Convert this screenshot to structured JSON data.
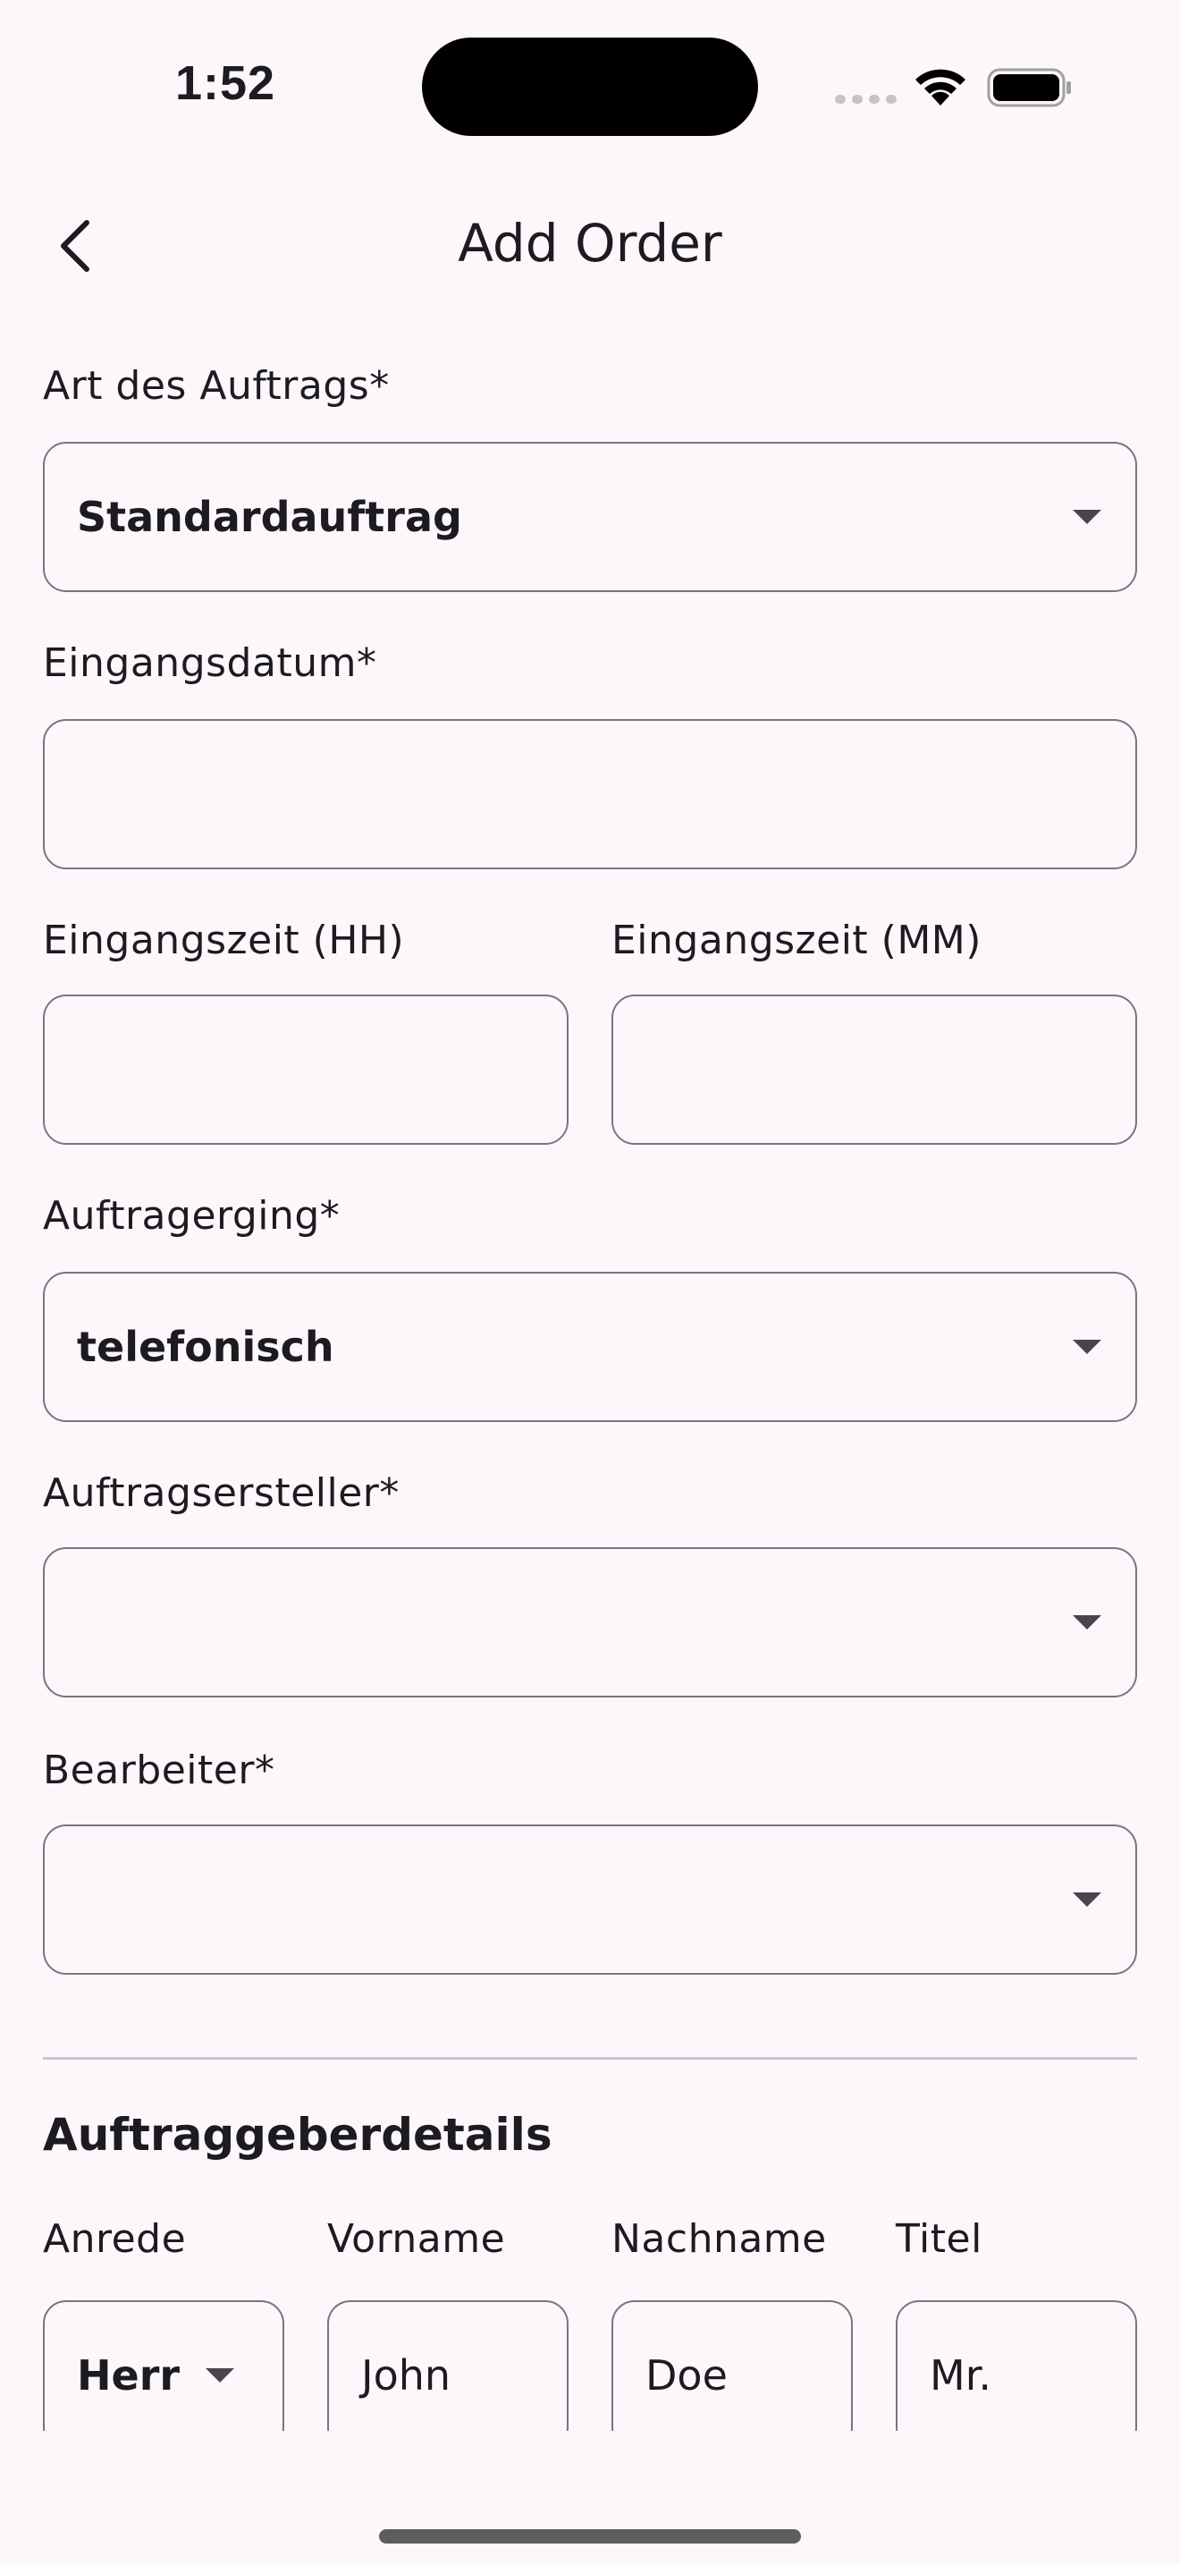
{
  "status_bar": {
    "time": "1:52"
  },
  "app_bar": {
    "title": "Add Order"
  },
  "form": {
    "order_type": {
      "label": "Art des Auftrags*",
      "value": "Standardauftrag"
    },
    "receipt_date": {
      "label": "Eingangsdatum*",
      "value": ""
    },
    "receipt_time_hh": {
      "label": "Eingangszeit (HH)",
      "value": ""
    },
    "receipt_time_mm": {
      "label": "Eingangszeit (MM)",
      "value": ""
    },
    "order_received": {
      "label": "Auftragerging*",
      "value": "telefonisch"
    },
    "order_creator": {
      "label": "Auftragsersteller*",
      "value": ""
    },
    "editor": {
      "label": "Bearbeiter*",
      "value": ""
    }
  },
  "client_details": {
    "title": "Auftraggeberdetails",
    "salutation": {
      "label": "Anrede",
      "value": "Herr"
    },
    "first_name": {
      "label": "Vorname",
      "value": "John"
    },
    "last_name": {
      "label": "Nachname",
      "value": "Doe"
    },
    "title_field": {
      "label": "Titel",
      "value": "Mr."
    }
  },
  "icons": {
    "back": "chevron-left-icon",
    "dropdown": "arrow-drop-down-icon",
    "wifi": "wifi-icon",
    "battery": "battery-icon",
    "signal": "cellular-signal-icon"
  }
}
